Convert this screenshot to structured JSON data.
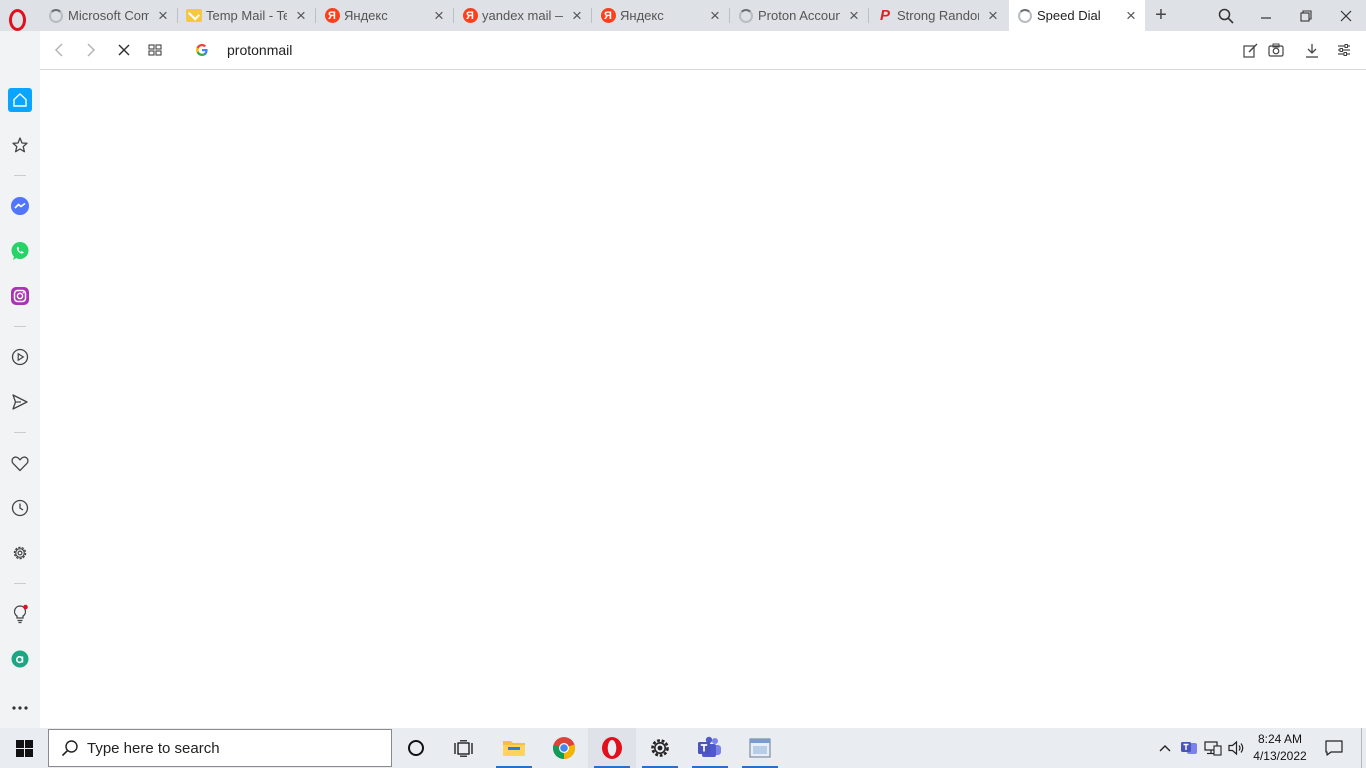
{
  "browser": {
    "tabs": [
      {
        "title": "Microsoft Comm",
        "favicon": "loading-spinner",
        "active": false
      },
      {
        "title": "Temp Mail - Tem",
        "favicon": "temp-mail-icon",
        "active": false
      },
      {
        "title": "Яндекс",
        "favicon": "yandex-icon",
        "active": false
      },
      {
        "title": "yandex mail —",
        "favicon": "yandex-icon",
        "active": false
      },
      {
        "title": "Яндекс",
        "favicon": "yandex-icon",
        "active": false
      },
      {
        "title": "Proton Account",
        "favicon": "loading-spinner",
        "active": false
      },
      {
        "title": "Strong Random",
        "favicon": "p-logo-icon",
        "active": false
      },
      {
        "title": "Speed Dial",
        "favicon": "loading-spinner",
        "active": true
      }
    ],
    "address": {
      "value": "protonmail",
      "search_engine": "google-icon"
    },
    "sidebar": [
      "home-icon",
      "bookmarks-icon",
      "messenger-icon",
      "whatsapp-icon",
      "instagram-icon",
      "player-icon",
      "send-icon",
      "heart-icon",
      "history-icon",
      "settings-icon",
      "lightbulb-icon",
      "aria-icon",
      "more-icon"
    ]
  },
  "taskbar": {
    "search_placeholder": "Type here to search",
    "clock_time": "8:24 AM",
    "clock_date": "4/13/2022"
  },
  "colors": {
    "opera_red": "#e0101d",
    "sidebar_active": "#0aa5ff",
    "tab_strip": "#dee1e6"
  }
}
